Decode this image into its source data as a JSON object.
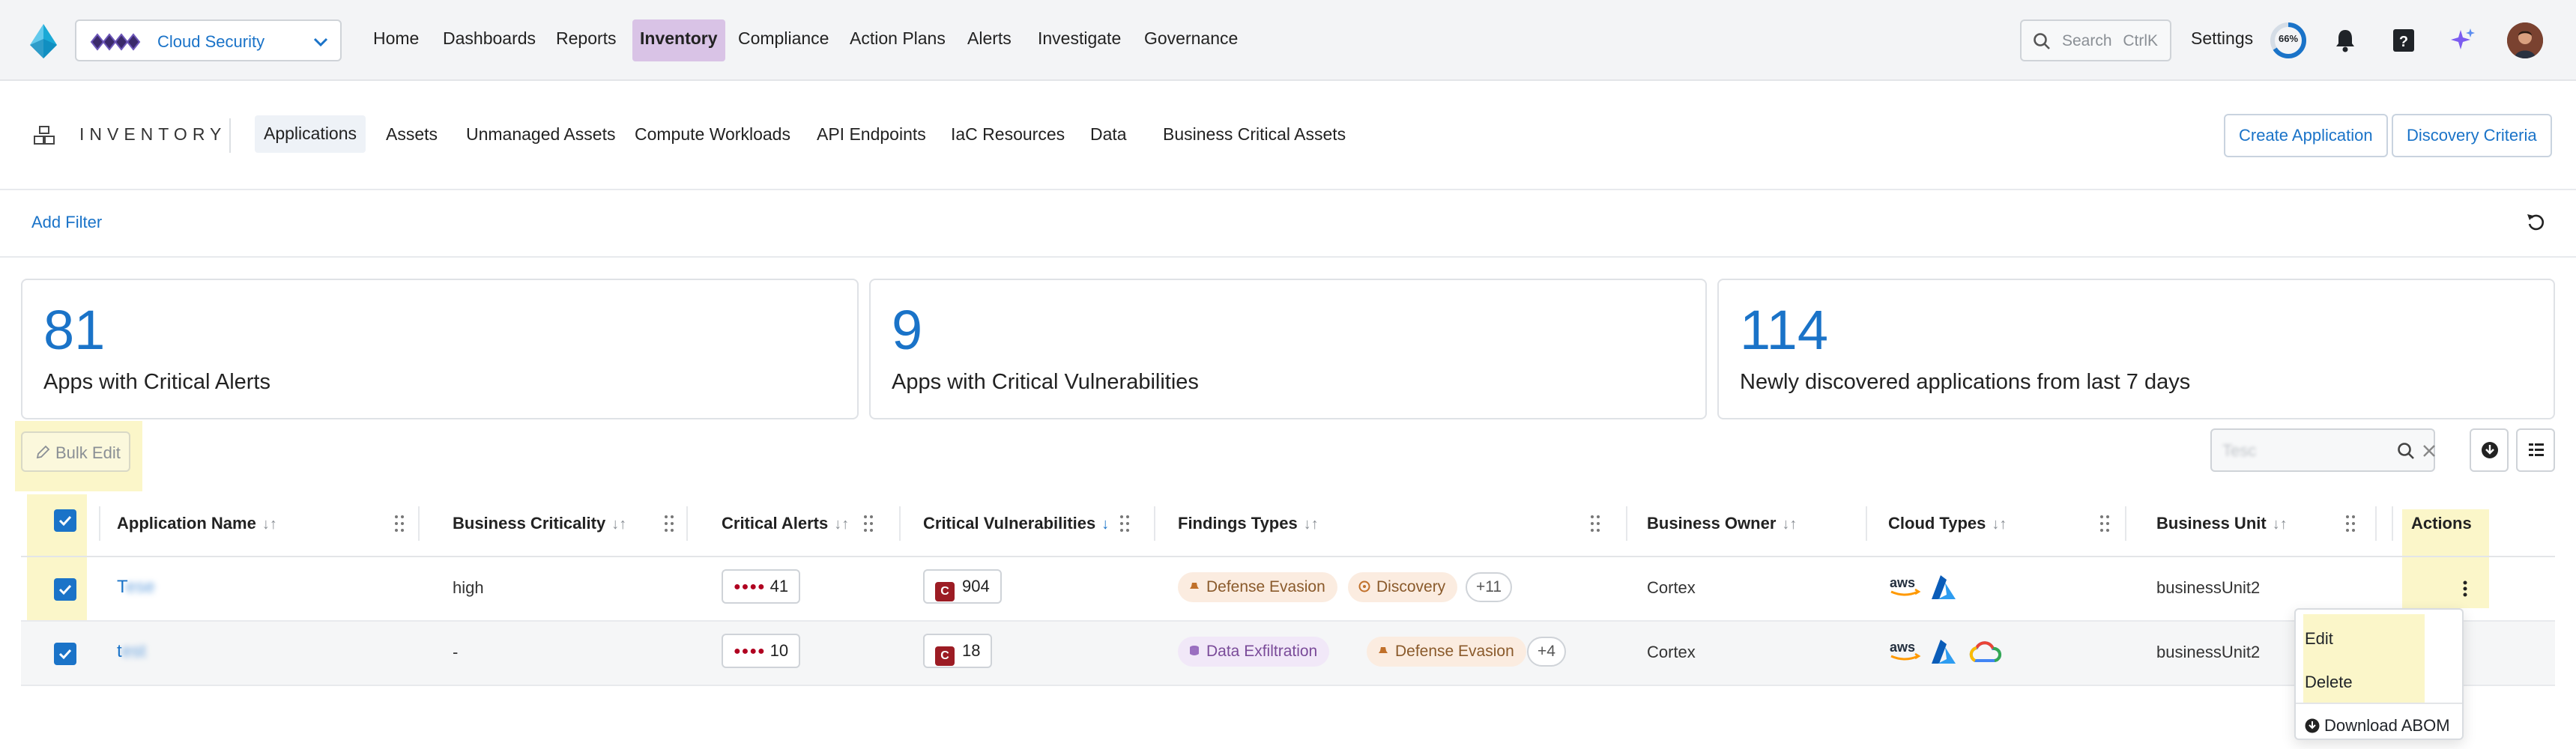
{
  "topnav": {
    "tenant": "Cloud Security",
    "links": [
      "Home",
      "Dashboards",
      "Reports",
      "Inventory",
      "Compliance",
      "Action Plans",
      "Alerts",
      "Investigate",
      "Governance"
    ],
    "active": "Inventory",
    "search_placeholder": "Search",
    "search_shortcut": "CtrlK",
    "settings": "Settings",
    "progress_percent": 66,
    "progress_label": "66%"
  },
  "inventory": {
    "title": "INVENTORY",
    "tabs": [
      "Applications",
      "Assets",
      "Unmanaged Assets",
      "Compute Workloads",
      "API Endpoints",
      "IaC Resources",
      "Data",
      "Business Critical Assets"
    ],
    "active_tab": "Applications",
    "create_button": "Create Application",
    "discovery_button": "Discovery Criteria"
  },
  "filter": {
    "add_filter": "Add Filter"
  },
  "stats": [
    {
      "value": "81",
      "label": "Apps with Critical Alerts"
    },
    {
      "value": "9",
      "label": "Apps with Critical Vulnerabilities"
    },
    {
      "value": "114",
      "label": "Newly discovered applications from last 7 days"
    }
  ],
  "toolbar": {
    "bulk_edit": "Bulk Edit",
    "search_value": "Tesc"
  },
  "table": {
    "columns": [
      "Application Name",
      "Business Criticality",
      "Critical Alerts",
      "Critical Vulnerabilities",
      "Findings Types",
      "Business Owner",
      "Cloud Types",
      "Business Unit",
      "Actions"
    ],
    "rows": [
      {
        "name_visible": "T",
        "name_hidden": "ese",
        "criticality": "high",
        "critical_alerts": "41",
        "critical_vulns": "904",
        "vuln_badge": "C",
        "findings": [
          "Defense Evasion",
          "Discovery"
        ],
        "findings_more": "+11",
        "owner": "Cortex",
        "clouds": [
          "aws",
          "azure"
        ],
        "unit": "businessUnit2"
      },
      {
        "name_visible": "t",
        "name_hidden": "est",
        "criticality": "-",
        "critical_alerts": "10",
        "critical_vulns": "18",
        "vuln_badge": "C",
        "findings": [
          "Data Exfiltration",
          "Defense Evasion"
        ],
        "findings_more": "+4",
        "owner": "Cortex",
        "clouds": [
          "aws",
          "azure",
          "gcp"
        ],
        "unit": "businessUnit2"
      }
    ]
  },
  "action_menu": {
    "edit": "Edit",
    "delete": "Delete",
    "download": "Download ABOM"
  },
  "colors": {
    "accent": "#1a73c8",
    "active_nav": "#d9c3e6",
    "highlight": "#fbf6c9",
    "critical": "#9c1c24"
  }
}
